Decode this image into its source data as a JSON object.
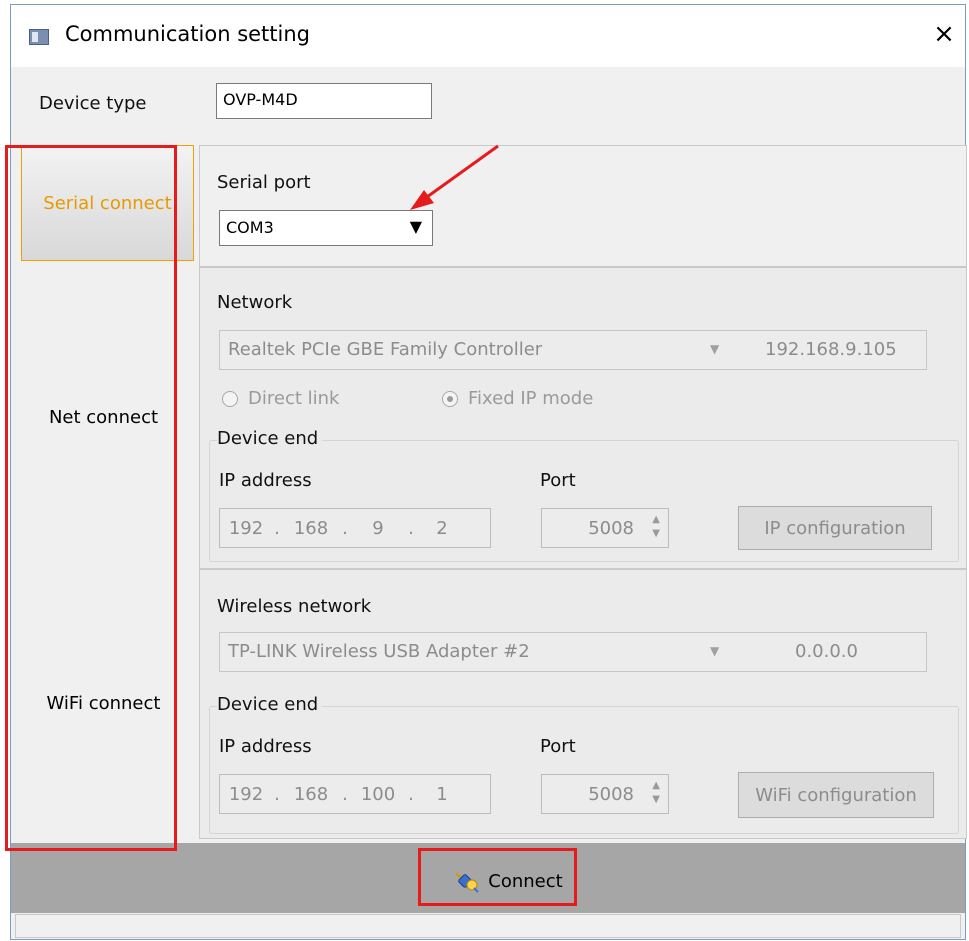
{
  "window": {
    "title": "Communication setting",
    "close_glyph": "×",
    "icon": "app-window-icon"
  },
  "device_type": {
    "label": "Device type",
    "value": "OVP-M4D"
  },
  "sidebar": {
    "items": [
      {
        "label": "Serial connect",
        "active": true
      },
      {
        "label": "Net connect",
        "active": false
      },
      {
        "label": "WiFi connect",
        "active": false
      }
    ]
  },
  "serial": {
    "label": "Serial port",
    "value": "COM3",
    "arrow": "▼"
  },
  "network": {
    "label": "Network",
    "adapter": "Realtek PCIe GBE Family Controller",
    "ip": "192.168.9.105",
    "arrow": "▼",
    "radio_direct": "Direct link",
    "radio_fixed": "Fixed IP mode",
    "device_end_label": "Device end",
    "ip_address_label": "IP address",
    "ip_octets": [
      "192",
      "168",
      "9",
      "2"
    ],
    "port_label": "Port",
    "port_value": "5008",
    "config_button": "IP configuration"
  },
  "wireless": {
    "label": "Wireless network",
    "adapter": "TP-LINK Wireless USB Adapter #2",
    "ip": "0.0.0.0",
    "arrow": "▼",
    "device_end_label": "Device end",
    "ip_address_label": "IP address",
    "ip_octets": [
      "192",
      "168",
      "100",
      "1"
    ],
    "port_label": "Port",
    "port_value": "5008",
    "config_button": "WiFi configuration"
  },
  "footer": {
    "connect_label": "Connect",
    "connect_icon": "plug-connect-icon"
  },
  "colors": {
    "active_tab": "#e69a00",
    "annotation": "#e61b1b",
    "bottom_bar": "#a6a6a6"
  }
}
